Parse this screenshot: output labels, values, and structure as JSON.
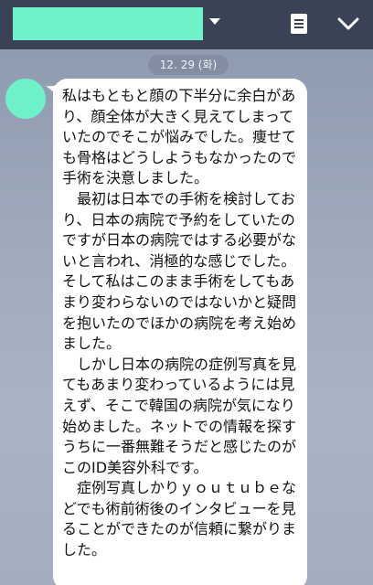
{
  "header": {
    "contact_name": "",
    "dropdown_icon": "caret-down-icon",
    "memo_icon": "memo-icon",
    "collapse_icon": "chevron-down-icon",
    "bar_color": "#3a4256",
    "name_block_color": "#6ff2c9"
  },
  "date_separator": "12. 29 (화)",
  "message": {
    "avatar_color": "#6ff2c9",
    "paragraphs": [
      "私はもともと顔の下半分に余白があり、顔全体が大きく見えてしまっていたのでそこが悩みでした。痩せても骨格はどうしようもなかったので手術を決意しました。",
      "　最初は日本での手術を検討しており、日本の病院で予約をしていたのですが日本の病院ではする必要がないと言われ、消極的な感じでした。そして私はこのまま手術をしてもあまり変わらないのではないかと疑問を抱いたのでほかの病院を考え始めました。",
      "　しかし日本の病院の症例写真を見てもあまり変わっているようには見えず、そこで韓国の病院が気になり始めました。ネットでの情報を探すうちに一番無難そうだと感じたのがこのID美容外科です。",
      "　症例写真しかりｙｏｕｔｕｂｅなどでも術前術後のインタビューを見ることができたのが信頼に繋がりました。"
    ]
  }
}
